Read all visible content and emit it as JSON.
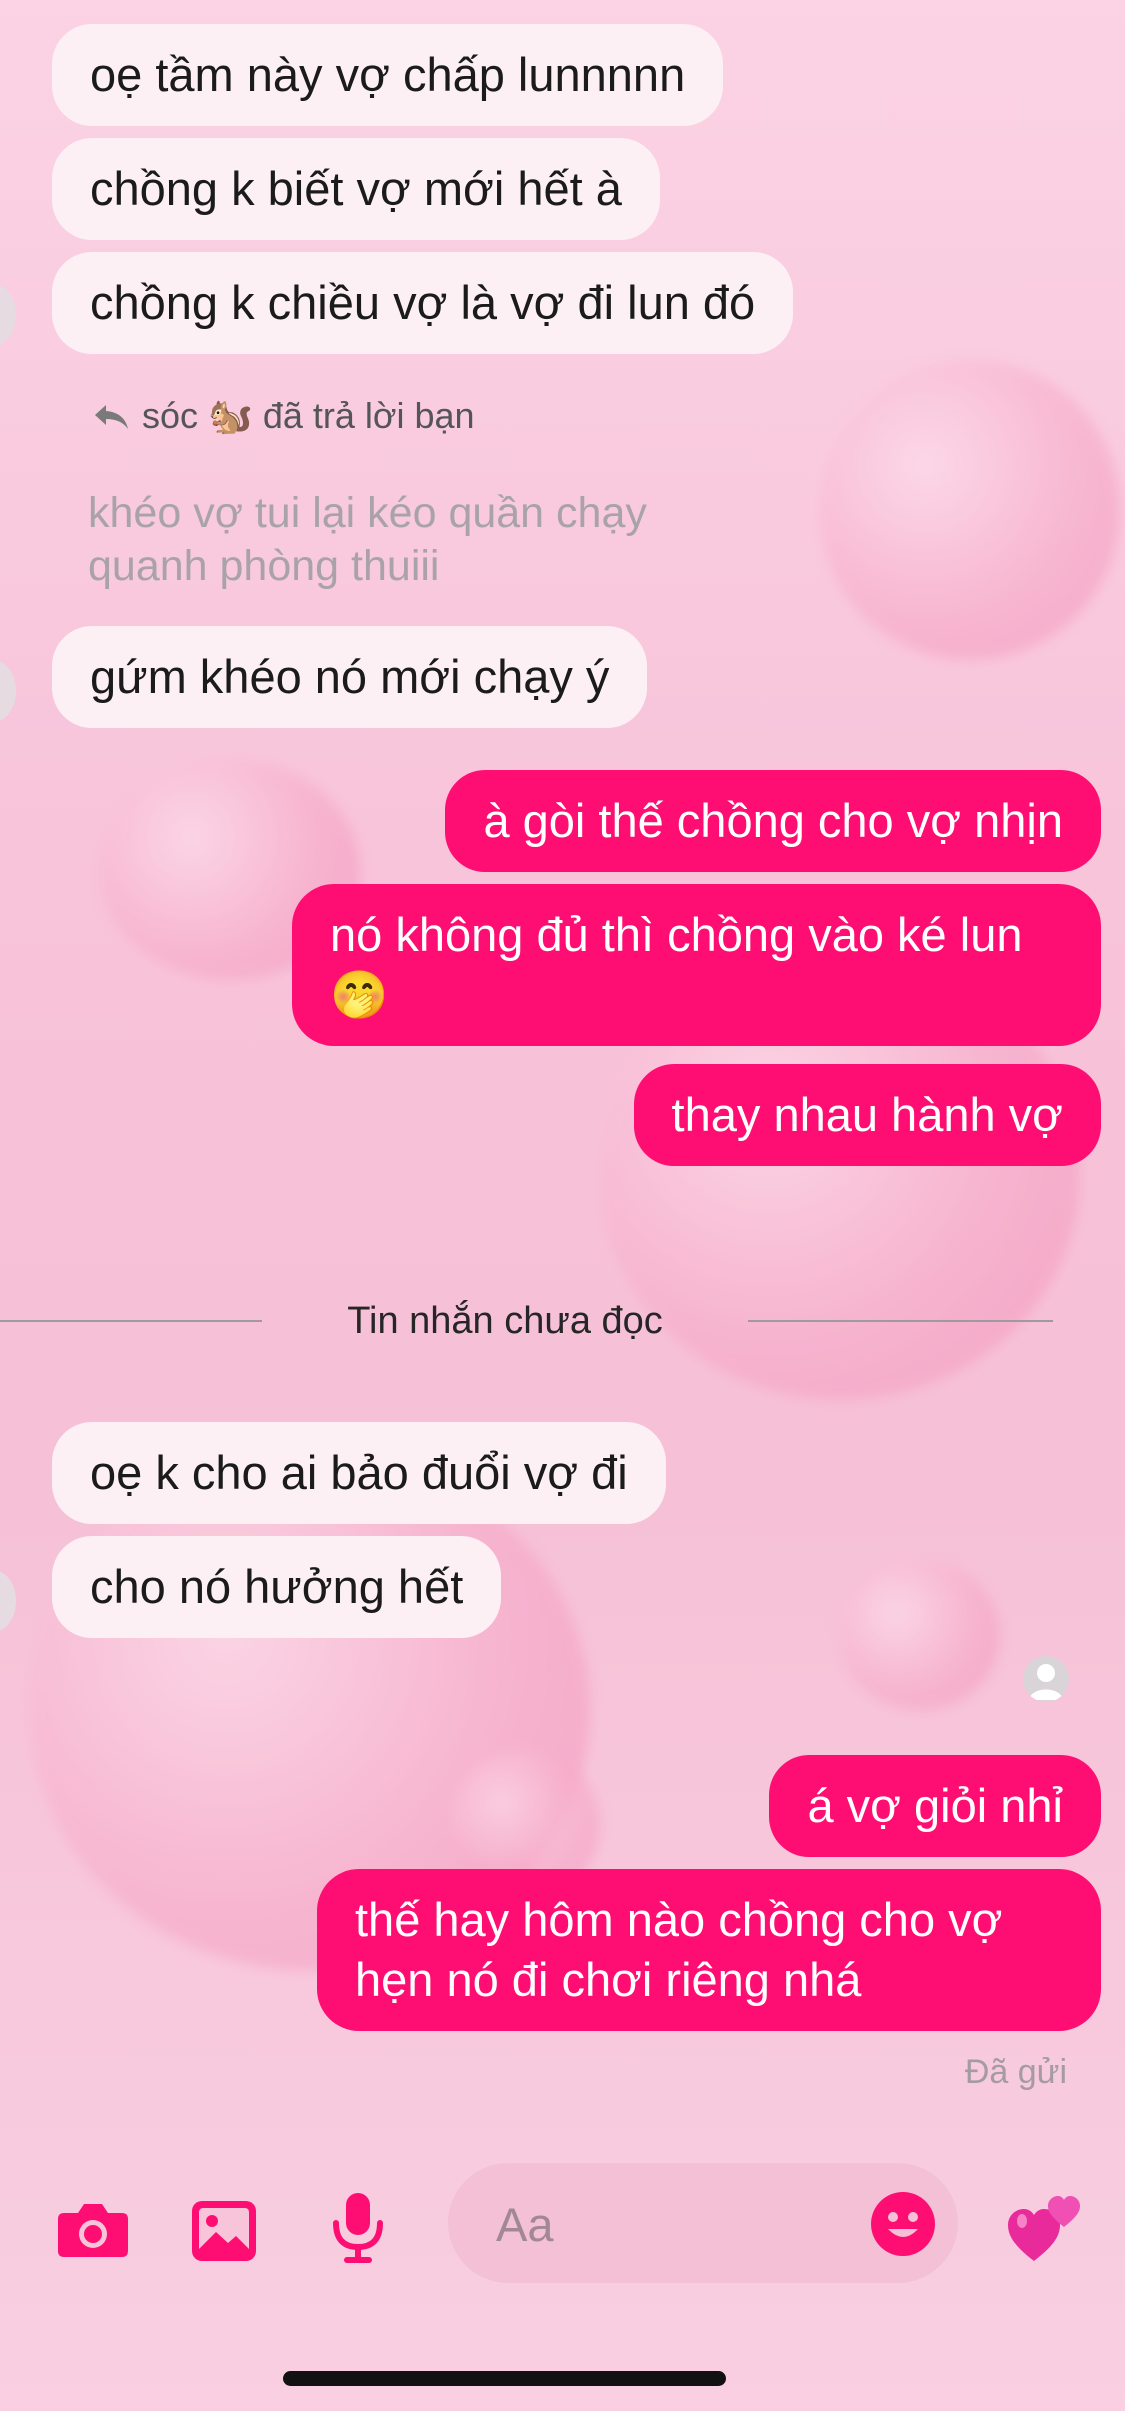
{
  "messages_before": [
    {
      "side": "in",
      "text": "oẹ tầm này vợ chấp lunnnnn"
    },
    {
      "side": "in",
      "text": "chồng k biết vợ mới hết à"
    },
    {
      "side": "in",
      "text": "chồng k chiều vợ là vợ đi lun đó"
    }
  ],
  "reply": {
    "note": "sóc 🐿️ đã trả lời bạn",
    "quoted": "khéo vợ tui lại kéo quần chạy quanh phòng thuiii",
    "text": "gứm khéo nó mới chạy ý"
  },
  "outgoing_1": [
    {
      "text": "à gòi thế chồng cho vợ nhịn"
    },
    {
      "text": "nó không đủ thì chồng vào ké lun 🤭"
    },
    {
      "text": "thay nhau hành vợ"
    }
  ],
  "divider_label": "Tin nhắn chưa đọc",
  "messages_after": [
    {
      "text": "oẹ k cho ai bảo đuổi vợ đi"
    },
    {
      "text": "cho nó hưởng hết"
    }
  ],
  "outgoing_2": [
    {
      "text": "á vợ giỏi nhỉ"
    },
    {
      "text": "thế hay hôm nào chồng cho vợ hẹn nó đi chơi riêng nhá"
    }
  ],
  "sent_status": "Đã gửi",
  "composer": {
    "placeholder": "Aa"
  },
  "toolbar_icons": [
    "camera-icon",
    "gallery-icon",
    "microphone-icon",
    "emoji-icon",
    "hearts-icon"
  ],
  "colors": {
    "accent": "#fe0e72",
    "incoming_bubble": "#fdf0f4",
    "background": "#f8c4da"
  }
}
